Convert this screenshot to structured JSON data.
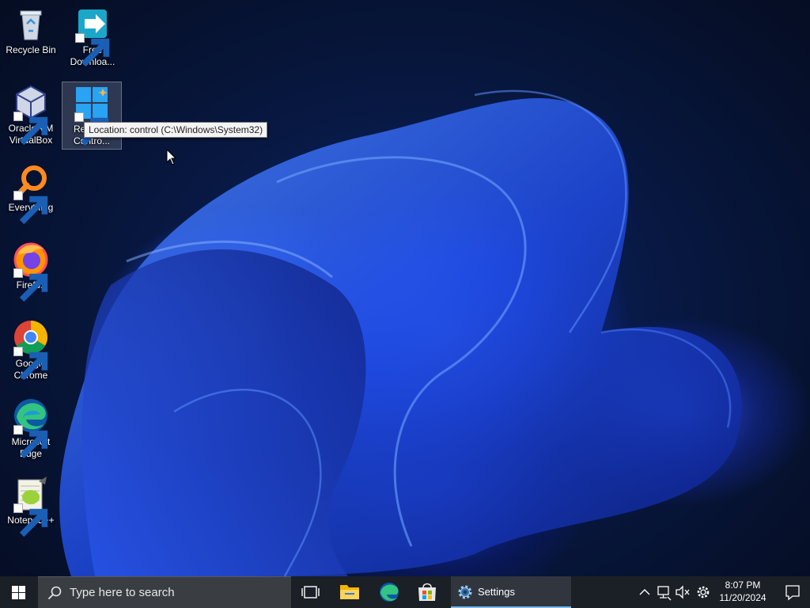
{
  "desktop": {
    "icons": [
      {
        "label": "Recycle Bin",
        "icon": "recycle-bin-icon"
      },
      {
        "label": "Free Downloa...",
        "icon": "free-download-manager-icon"
      },
      {
        "label": "Oracle VM VirtualBox",
        "icon": "virtualbox-icon"
      },
      {
        "label": "Re... Contro...",
        "label_line1": "Re",
        "label_line2": "Contro...",
        "icon": "control-panel-icon"
      },
      {
        "label": "Everything",
        "icon": "everything-search-icon"
      },
      {
        "label": "Firefox",
        "icon": "firefox-icon"
      },
      {
        "label_line1": "Google",
        "label_line2": "Chrome",
        "icon": "chrome-icon"
      },
      {
        "label_line1": "Microsoft",
        "label_line2": "Edge",
        "icon": "edge-icon"
      },
      {
        "label": "Notepad++",
        "icon": "notepad-plus-plus-icon"
      }
    ],
    "tooltip": "Location: control (C:\\Windows\\System32)"
  },
  "taskbar": {
    "search_placeholder": "Type here to search",
    "settings_label": "Settings",
    "time": "8:07 PM",
    "date": "11/20/2024"
  },
  "colors": {
    "taskbar_bg": "#1b1f26",
    "search_bg": "#3a3d42",
    "active_underline": "#76b9ed",
    "wallpaper_blue": "#1e46df"
  }
}
